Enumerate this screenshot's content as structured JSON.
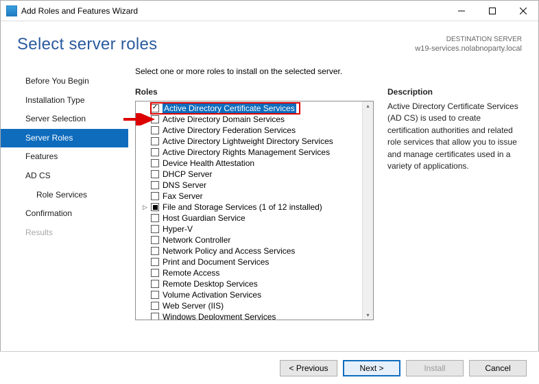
{
  "window": {
    "title": "Add Roles and Features Wizard"
  },
  "page": {
    "heading": "Select server roles",
    "destination_label": "DESTINATION SERVER",
    "destination_value": "w19-services.nolabnoparty.local",
    "instruction": "Select one or more roles to install on the selected server."
  },
  "sidenav": {
    "items": [
      {
        "label": "Before You Begin",
        "state": "normal"
      },
      {
        "label": "Installation Type",
        "state": "normal"
      },
      {
        "label": "Server Selection",
        "state": "normal"
      },
      {
        "label": "Server Roles",
        "state": "selected"
      },
      {
        "label": "Features",
        "state": "normal"
      },
      {
        "label": "AD CS",
        "state": "normal"
      },
      {
        "label": "Role Services",
        "state": "normal",
        "sub": true
      },
      {
        "label": "Confirmation",
        "state": "normal"
      },
      {
        "label": "Results",
        "state": "disabled"
      }
    ]
  },
  "roles": {
    "title": "Roles",
    "items": [
      {
        "label": "Active Directory Certificate Services",
        "checked": true,
        "highlighted": true
      },
      {
        "label": "Active Directory Domain Services",
        "checked": false
      },
      {
        "label": "Active Directory Federation Services",
        "checked": false
      },
      {
        "label": "Active Directory Lightweight Directory Services",
        "checked": false
      },
      {
        "label": "Active Directory Rights Management Services",
        "checked": false
      },
      {
        "label": "Device Health Attestation",
        "checked": false
      },
      {
        "label": "DHCP Server",
        "checked": false
      },
      {
        "label": "DNS Server",
        "checked": false
      },
      {
        "label": "Fax Server",
        "checked": false
      },
      {
        "label": "File and Storage Services (1 of 12 installed)",
        "checked": "partial",
        "expandable": true
      },
      {
        "label": "Host Guardian Service",
        "checked": false
      },
      {
        "label": "Hyper-V",
        "checked": false
      },
      {
        "label": "Network Controller",
        "checked": false
      },
      {
        "label": "Network Policy and Access Services",
        "checked": false
      },
      {
        "label": "Print and Document Services",
        "checked": false
      },
      {
        "label": "Remote Access",
        "checked": false
      },
      {
        "label": "Remote Desktop Services",
        "checked": false
      },
      {
        "label": "Volume Activation Services",
        "checked": false
      },
      {
        "label": "Web Server (IIS)",
        "checked": false
      },
      {
        "label": "Windows Deployment Services",
        "checked": false
      }
    ]
  },
  "description": {
    "title": "Description",
    "text": "Active Directory Certificate Services (AD CS) is used to create certification authorities and related role services that allow you to issue and manage certificates used in a variety of applications."
  },
  "buttons": {
    "previous": "< Previous",
    "next": "Next >",
    "install": "Install",
    "cancel": "Cancel"
  }
}
